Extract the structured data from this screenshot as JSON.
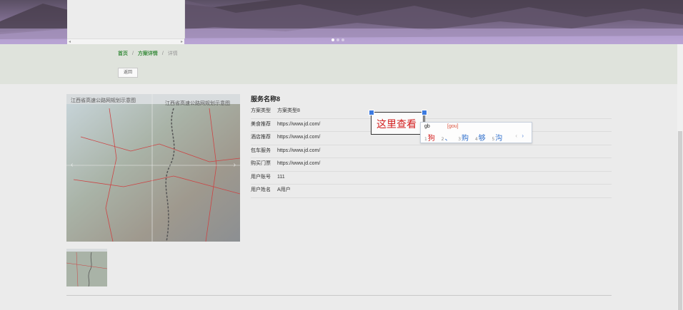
{
  "breadcrumb": {
    "home": "首页",
    "plan_detail": "方案详情",
    "current": "详情",
    "sep": "/"
  },
  "back_button": "返回",
  "service": {
    "title": "服务名称8",
    "rows": [
      {
        "label": "方案类型",
        "value": "方案类型8"
      },
      {
        "label": "美食推荐",
        "value": "https://www.jd.com/"
      },
      {
        "label": "酒店推荐",
        "value": "https://www.jd.com/"
      },
      {
        "label": "包车服务",
        "value": "https://www.jd.com/"
      },
      {
        "label": "购买门票",
        "value": "https://www.jd.com/"
      },
      {
        "label": "用户账号",
        "value": "111"
      },
      {
        "label": "用户姓名",
        "value": "A用户"
      }
    ]
  },
  "map_caption_left": "江西省高速公路网规划示意图",
  "map_caption_right": "江西省高速公路网规划示意图",
  "annotation_text": "这里查看",
  "ime": {
    "input": "gb",
    "pinyin": "[gou]",
    "candidates": [
      {
        "num": "1",
        "text": "狗"
      },
      {
        "num": "2",
        "text": "、"
      },
      {
        "num": "3",
        "text": "购"
      },
      {
        "num": "4",
        "text": "够"
      },
      {
        "num": "5",
        "text": "沟"
      }
    ],
    "prev": "‹",
    "next": "›"
  },
  "colors": {
    "breadcrumb_link": "#3e8e41",
    "annotation_text": "#d32020",
    "handle": "#3d7be0"
  },
  "carousel": {
    "slides": 3,
    "active": 1
  }
}
